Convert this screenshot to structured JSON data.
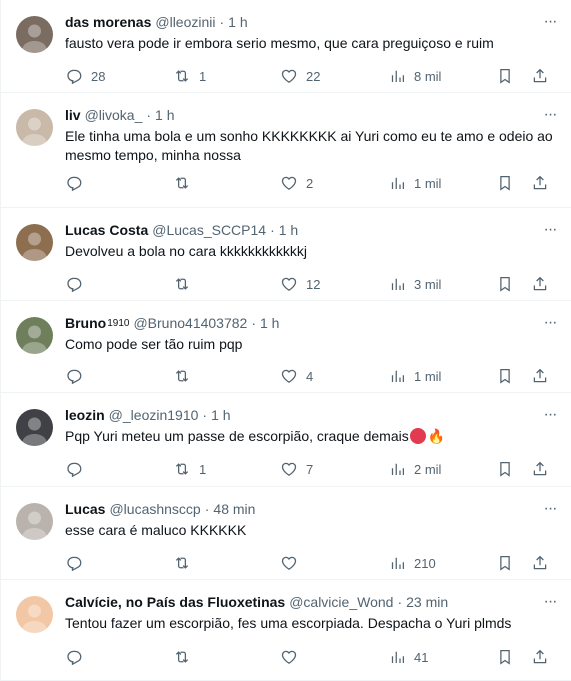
{
  "tweets": [
    {
      "name": "das morenas",
      "handle": "@lleozinii",
      "time": "1 h",
      "text": "fausto vera pode ir embora serio mesmo, que cara preguiçoso e ruim",
      "replies": "28",
      "retweets": "1",
      "likes": "22",
      "views": "8 mil",
      "avatar_color": "#7b6c61"
    },
    {
      "name": "liv",
      "handle": "@livoka_",
      "time": "1 h",
      "text": "Ele tinha uma bola e um sonho KKKKKKKK ai Yuri como eu te amo e odeio ao mesmo tempo, minha nossa",
      "replies": "",
      "retweets": "",
      "likes": "2",
      "views": "1 mil",
      "avatar_color": "#c9b9a8"
    },
    {
      "name": "Lucas Costa",
      "handle": "@Lucas_SCCP14",
      "time": "1 h",
      "text": "Devolveu a bola no cara kkkkkkkkkkkkj",
      "replies": "",
      "retweets": "",
      "likes": "12",
      "views": "3 mil",
      "avatar_color": "#8d6e4f"
    },
    {
      "name": "Bruno",
      "name_badge": "1910",
      "handle": "@Bruno41403782",
      "time": "1 h",
      "text": "Como pode ser tão ruim pqp",
      "replies": "",
      "retweets": "",
      "likes": "4",
      "views": "1 mil",
      "avatar_color": "#6f7f5c"
    },
    {
      "name": "leozin",
      "handle": "@_leozin1910",
      "time": "1 h",
      "text": "Pqp Yuri meteu um passe de escorpião, craque demais",
      "replies": "",
      "retweets": "1",
      "likes": "7",
      "views": "2 mil",
      "avatar_color": "#3f4146"
    },
    {
      "name": "Lucas",
      "handle": "@lucashnsccp",
      "time": "48 min",
      "text": "esse cara é maluco KKKKKK",
      "replies": "",
      "retweets": "",
      "likes": "",
      "views": "210",
      "avatar_color": "#b9b2ad"
    },
    {
      "name": "Calvície, no País das Fluoxetinas",
      "handle": "@calvicie_Wond",
      "time": "23 min",
      "text": "Tentou fazer um escorpião, fes uma escorpiada. Despacha o Yuri plmds",
      "replies": "",
      "retweets": "",
      "likes": "",
      "views": "41",
      "avatar_color": "#f2c7a5"
    }
  ],
  "icons": {
    "reply": "reply-icon",
    "retweet": "retweet-icon",
    "like": "heart-icon",
    "views": "views-icon",
    "bookmark": "bookmark-icon",
    "share": "share-icon",
    "more": "more-icon"
  },
  "colors": {
    "text": "#0f1419",
    "muted": "#536471",
    "divider": "#eff3f4"
  }
}
